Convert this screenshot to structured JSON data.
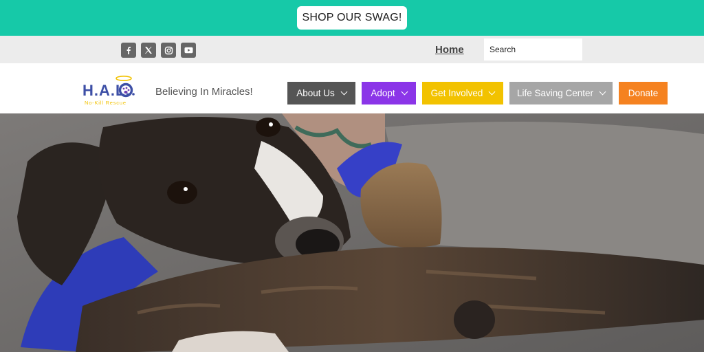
{
  "promo": {
    "button_label": "SHOP OUR SWAG!"
  },
  "social": [
    "facebook-icon",
    "x-icon",
    "instagram-icon",
    "youtube-icon"
  ],
  "util": {
    "home_label": "Home",
    "search_placeholder": "Search"
  },
  "header": {
    "logo_text": "H.A.L.O.",
    "logo_subtext": "No-Kill Rescue",
    "tagline": "Believing In Miracles!"
  },
  "nav": [
    {
      "label": "About Us",
      "color": "#555555"
    },
    {
      "label": "Adopt",
      "color": "#8b35e8"
    },
    {
      "label": "Get Involved",
      "color": "#f2c200"
    },
    {
      "label": "Life Saving Center",
      "color": "#a6a6a6"
    },
    {
      "label": "Donate",
      "color": "#f58220"
    }
  ],
  "colors": {
    "promo_bg": "#16c9a8",
    "util_bg": "#ececec",
    "logo_blue": "#3d4fa6",
    "logo_purple": "#6d3fb0",
    "halo_yellow": "#f2c200"
  }
}
